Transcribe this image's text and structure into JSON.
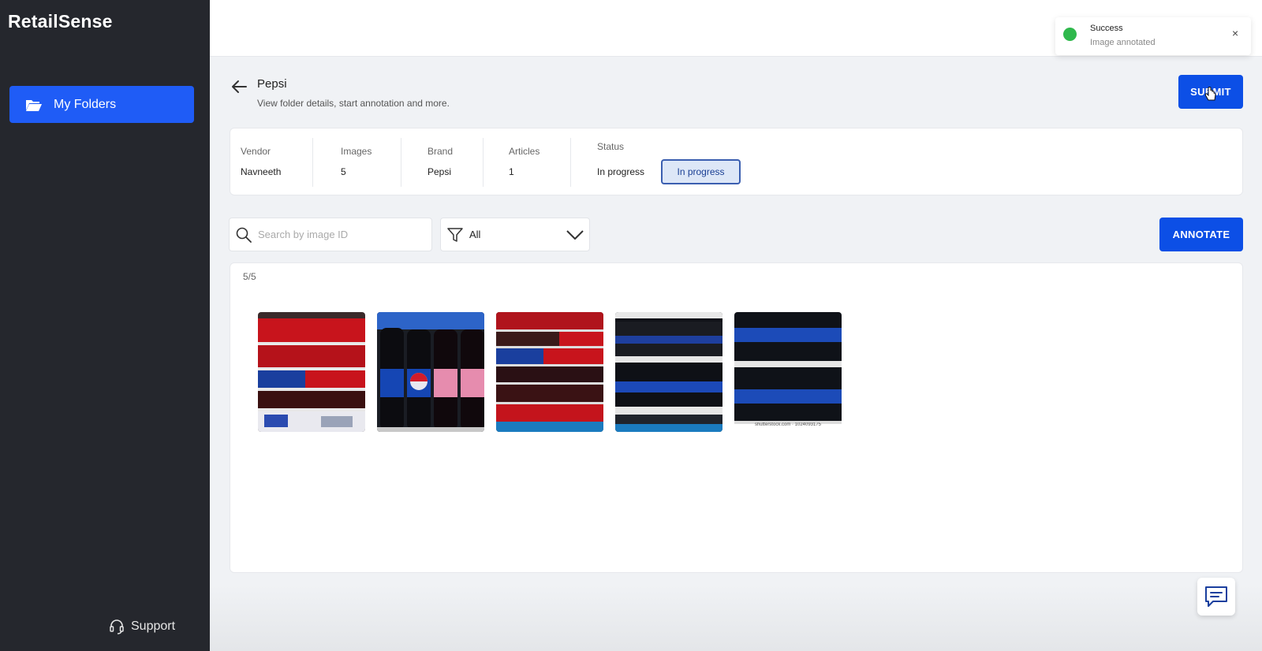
{
  "app": {
    "name": "RetailSense"
  },
  "sidebar": {
    "items": [
      {
        "label": "My Folders",
        "icon": "folder-open-icon"
      }
    ],
    "support_label": "Support"
  },
  "toast": {
    "title": "Success",
    "message": "Image annotated",
    "close": "×",
    "status_color": "#2fb84c"
  },
  "header": {
    "title": "Pepsi",
    "subtitle": "View folder details, start annotation and more.",
    "submit_label": "SUBMIT"
  },
  "folder_info": {
    "vendor": {
      "label": "Vendor",
      "value": "Navneeth"
    },
    "images": {
      "label": "Images",
      "value": "5"
    },
    "brand": {
      "label": "Brand",
      "value": "Pepsi"
    },
    "articles": {
      "label": "Articles",
      "value": "1"
    },
    "status": {
      "label": "Status",
      "value": "In progress",
      "selected": "In progress"
    }
  },
  "filters": {
    "search_placeholder": "Search by image ID",
    "filter_value": "All",
    "annotate_label": "ANNOTATE"
  },
  "gallery": {
    "count": "5/5",
    "images": [
      {
        "name": "image-1"
      },
      {
        "name": "image-2"
      },
      {
        "name": "image-3"
      },
      {
        "name": "image-4"
      },
      {
        "name": "image-5",
        "watermark": "shutterstock.com · 1024093175"
      }
    ]
  },
  "colors": {
    "accent": "#0c4fe6",
    "sidebar_bg": "#25272d",
    "nav_active": "#1f5cf6"
  }
}
